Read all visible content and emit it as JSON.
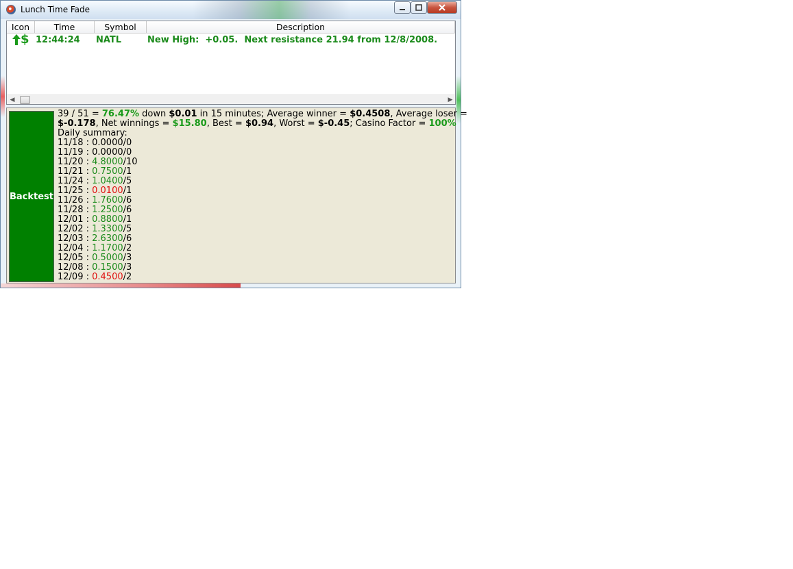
{
  "window": {
    "title": "Lunch Time Fade",
    "controls": {
      "minimize": "0",
      "maximize": "1",
      "close": "X"
    }
  },
  "alerts": {
    "columns": [
      "Icon",
      "Time",
      "Symbol",
      "Description"
    ],
    "rows": [
      {
        "icon": "up-arrow-dollar-icon",
        "dollar": "$",
        "time": "12:44:24",
        "symbol": "NATL",
        "description": "New High:  +0.05.  Next resistance 21.94 from 12/8/2008."
      }
    ]
  },
  "backtest": {
    "button_label": "Backtest",
    "summary": {
      "ratio": "39 / 51 = ",
      "success_pct": "76.47%",
      "t1": " down ",
      "down_amount": "$0.01",
      "t2": " in 15 minutes; Average winner = ",
      "avg_winner": "$0.4508",
      "t3": ", Average loser = ",
      "avg_loser": "$-0.178",
      "t4": ", Net winnings = ",
      "net_winnings": "$15.80",
      "t5": ", Best = ",
      "best": "$0.94",
      "t6": ", Worst = ",
      "worst": "$-0.45",
      "t7": "; Casino Factor = ",
      "casino_factor": "100%"
    },
    "daily_label": "Daily summary:",
    "daily": [
      {
        "date": "11/18",
        "value": "0.0000",
        "count": "0",
        "color": "black"
      },
      {
        "date": "11/19",
        "value": "0.0000",
        "count": "0",
        "color": "black"
      },
      {
        "date": "11/20",
        "value": "4.8000",
        "count": "10",
        "color": "green"
      },
      {
        "date": "11/21",
        "value": "0.7500",
        "count": "1",
        "color": "green"
      },
      {
        "date": "11/24",
        "value": "1.0400",
        "count": "5",
        "color": "green"
      },
      {
        "date": "11/25",
        "value": "0.0100",
        "count": "1",
        "color": "red"
      },
      {
        "date": "11/26",
        "value": "1.7600",
        "count": "6",
        "color": "green"
      },
      {
        "date": "11/28",
        "value": "1.2500",
        "count": "6",
        "color": "green"
      },
      {
        "date": "12/01",
        "value": "0.8800",
        "count": "1",
        "color": "green"
      },
      {
        "date": "12/02",
        "value": "1.3300",
        "count": "5",
        "color": "green"
      },
      {
        "date": "12/03",
        "value": "2.6300",
        "count": "6",
        "color": "green"
      },
      {
        "date": "12/04",
        "value": "1.1700",
        "count": "2",
        "color": "green"
      },
      {
        "date": "12/05",
        "value": "0.5000",
        "count": "3",
        "color": "green"
      },
      {
        "date": "12/08",
        "value": "0.1500",
        "count": "3",
        "color": "green"
      },
      {
        "date": "12/09",
        "value": "0.4500",
        "count": "2",
        "color": "red"
      }
    ]
  },
  "colors": {
    "backtest_green": "#008000",
    "positive": "#1a9a1a",
    "negative": "#e01010"
  }
}
